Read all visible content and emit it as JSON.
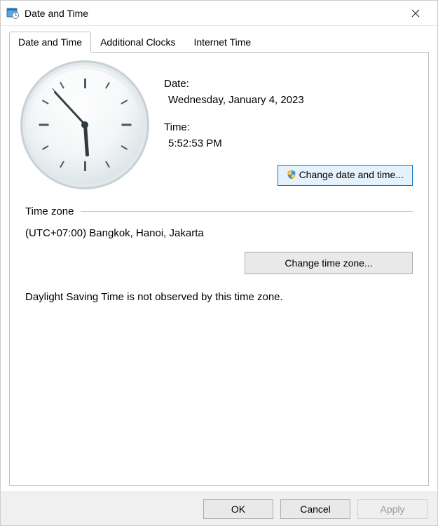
{
  "window": {
    "title": "Date and Time"
  },
  "tabs": [
    {
      "label": "Date and Time",
      "active": true
    },
    {
      "label": "Additional Clocks",
      "active": false
    },
    {
      "label": "Internet Time",
      "active": false
    }
  ],
  "datetime": {
    "date_label": "Date:",
    "date_value": "Wednesday, January 4, 2023",
    "time_label": "Time:",
    "time_value": "5:52:53 PM",
    "change_button": "Change date and time...",
    "clock": {
      "hour": 5,
      "minute": 52,
      "second": 53
    }
  },
  "timezone": {
    "section_label": "Time zone",
    "value": "(UTC+07:00) Bangkok, Hanoi, Jakarta",
    "change_button": "Change time zone...",
    "dst_note": "Daylight Saving Time is not observed by this time zone."
  },
  "footer": {
    "ok": "OK",
    "cancel": "Cancel",
    "apply": "Apply"
  }
}
